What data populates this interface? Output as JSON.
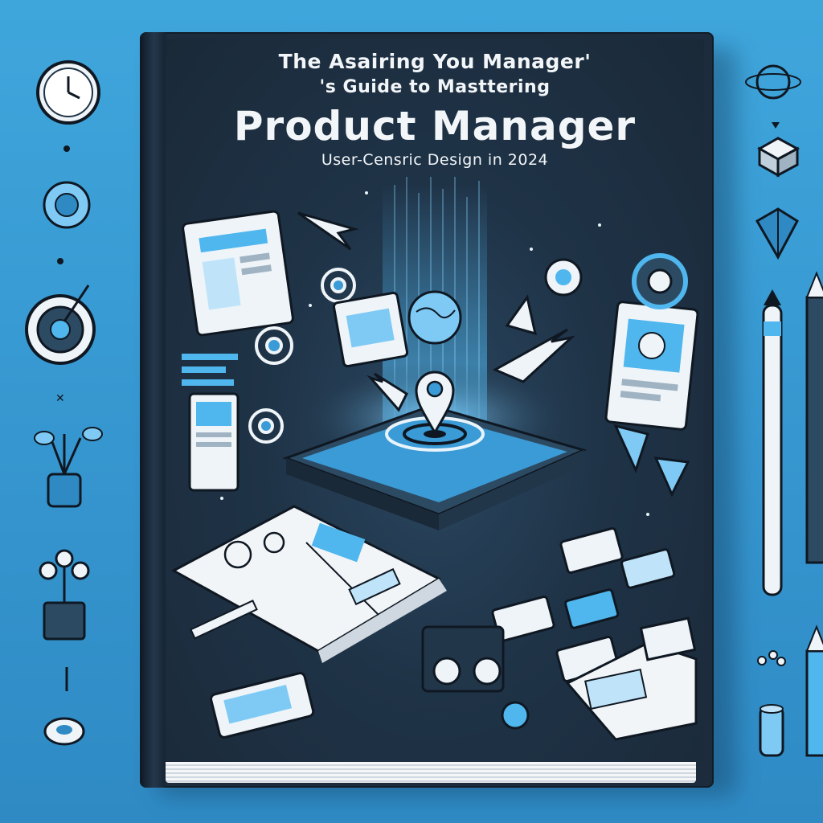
{
  "book": {
    "title_line_1": "The Asairing You Manager'",
    "title_line_2": "'s Guide to Masttering",
    "title_main": "Product Manager",
    "subtitle": "User-Censric Design in 2024"
  },
  "colors": {
    "background": "#3a9fd8",
    "cover": "#1f3347",
    "accent": "#4fb6ee",
    "paper": "#f2f5f8"
  },
  "decorations": {
    "left": [
      "clock-icon",
      "settings-dial-icon",
      "target-icon",
      "plant-icon",
      "robot-plant-icon",
      "ring-icon"
    ],
    "right": [
      "globe-icon",
      "cube-icon",
      "prism-icon",
      "pen-icon",
      "pencil-icon",
      "marker-icon"
    ]
  }
}
